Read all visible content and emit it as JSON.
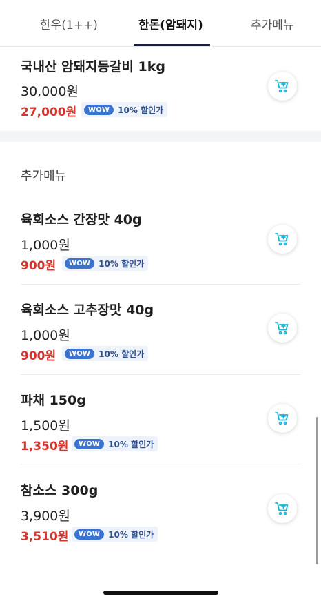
{
  "tabs": [
    {
      "label": "한우(1++)"
    },
    {
      "label": "한돈(암돼지)"
    },
    {
      "label": "추가메뉴"
    }
  ],
  "active_tab": "한돈(암돼지)",
  "section_title": "추가메뉴",
  "wow_badge": "WOW",
  "colors": {
    "sale_price": "#d8332a",
    "wow_badge_bg": "#3a74d0",
    "cart_icon": "#1ab3d6",
    "active_underline": "#1b1f3b"
  },
  "items": [
    {
      "name": "국내산 암돼지등갈비 1kg",
      "price": "30,000원",
      "sale_price": "27,000원",
      "discount": "10% 할인가"
    },
    {
      "name": "육회소스 간장맛 40g",
      "price": "1,000원",
      "sale_price": "900원",
      "discount": "10% 할인가"
    },
    {
      "name": "육회소스 고추장맛 40g",
      "price": "1,000원",
      "sale_price": "900원",
      "discount": "10% 할인가"
    },
    {
      "name": "파채 150g",
      "price": "1,500원",
      "sale_price": "1,350원",
      "discount": "10% 할인가"
    },
    {
      "name": "참소스 300g",
      "price": "3,900원",
      "sale_price": "3,510원",
      "discount": "10% 할인가"
    }
  ]
}
